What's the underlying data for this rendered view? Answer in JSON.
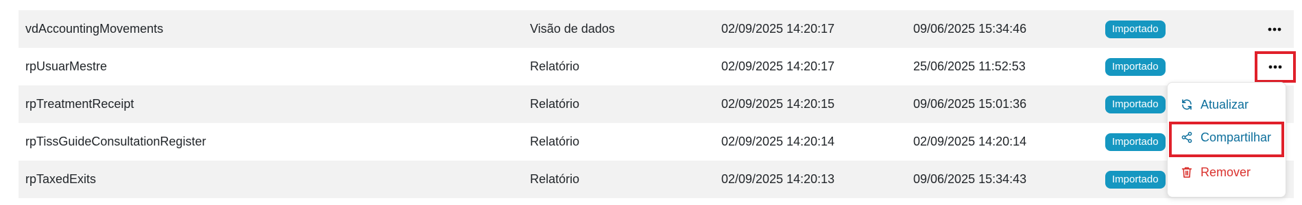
{
  "rows": [
    {
      "name": "vdAccountingMovements",
      "type": "Visão de dados",
      "created": "02/09/2025 14:20:17",
      "updated": "09/06/2025 15:34:46",
      "status": "Importado"
    },
    {
      "name": "rpUsuarMestre",
      "type": "Relatório",
      "created": "02/09/2025 14:20:17",
      "updated": "25/06/2025 11:52:53",
      "status": "Importado"
    },
    {
      "name": "rpTreatmentReceipt",
      "type": "Relatório",
      "created": "02/09/2025 14:20:15",
      "updated": "09/06/2025 15:01:36",
      "status": "Importado"
    },
    {
      "name": "rpTissGuideConsultationRegister",
      "type": "Relatório",
      "created": "02/09/2025 14:20:14",
      "updated": "02/09/2025 14:20:14",
      "status": "Importado"
    },
    {
      "name": "rpTaxedExits",
      "type": "Relatório",
      "created": "02/09/2025 14:20:13",
      "updated": "09/06/2025 15:34:43",
      "status": "Importado"
    }
  ],
  "menu": {
    "update_label": "Atualizar",
    "share_label": "Compartilhar",
    "remove_label": "Remover"
  },
  "colors": {
    "badge": "#1597c1",
    "accent": "#0d6f9c",
    "danger": "#d9302c",
    "highlight": "#e0202a",
    "row_shade": "#f2f2f2"
  },
  "icons": {
    "more": "more-horizontal-icon",
    "update": "refresh-icon",
    "share": "share-icon",
    "remove": "trash-icon"
  }
}
